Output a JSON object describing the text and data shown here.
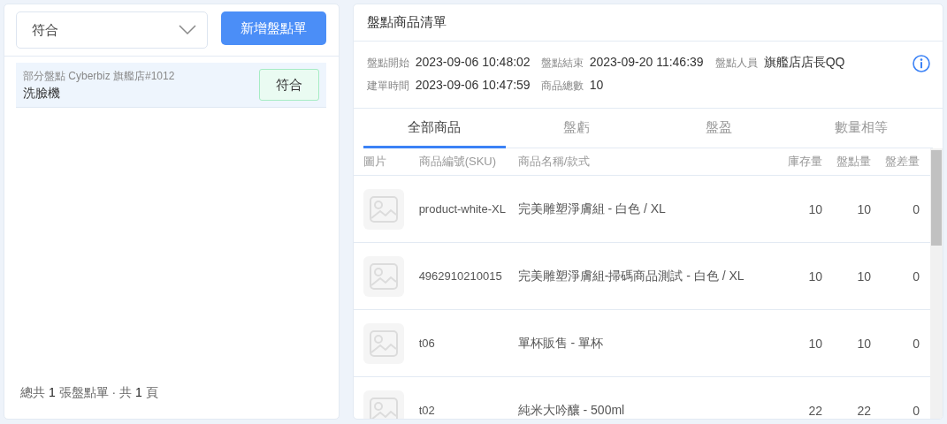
{
  "filter": {
    "value": "符合"
  },
  "new_button": "新增盤點單",
  "orders": [
    {
      "subtitle": "部分盤點 Cyberbiz 旗艦店#1012",
      "name": "洗臉機",
      "status": "符合",
      "selected": true
    }
  ],
  "footer": "總共 **1** 張盤點單 · 共 **1** 頁",
  "detail": {
    "title": "盤點商品清單",
    "info": [
      {
        "label": "盤點開始",
        "value": "2023-09-06 10:48:02"
      },
      {
        "label": "盤點結束",
        "value": "2023-09-20 11:46:39"
      },
      {
        "label": "盤點人員",
        "value": "旗艦店店長QQ"
      },
      {
        "label": "建單時間",
        "value": "2023-09-06 10:47:59"
      },
      {
        "label": "商品總數",
        "value": "10"
      }
    ],
    "tabs": [
      {
        "label": "全部商品",
        "selected": true
      },
      {
        "label": "盤虧",
        "selected": false
      },
      {
        "label": "盤盈",
        "selected": false
      },
      {
        "label": "數量相等",
        "selected": false
      }
    ],
    "columns": [
      "圖片",
      "商品編號(SKU)",
      "商品名稱/款式",
      "庫存量",
      "盤點量",
      "盤差量"
    ],
    "rows": [
      {
        "sku": "product-white-XL",
        "name": "完美雕塑淨膚組 - 白色 / XL",
        "stock": "10",
        "counted": "10",
        "diff": "0"
      },
      {
        "sku": "4962910210015",
        "name": "完美雕塑淨膚組-掃碼商品測試 - 白色 / XL",
        "stock": "10",
        "counted": "10",
        "diff": "0"
      },
      {
        "sku": "t06",
        "name": "單杯販售 - 單杯",
        "stock": "10",
        "counted": "10",
        "diff": "0"
      },
      {
        "sku": "t02",
        "name": "純米大吟釀 - 500ml",
        "stock": "22",
        "counted": "22",
        "diff": "0"
      }
    ]
  }
}
